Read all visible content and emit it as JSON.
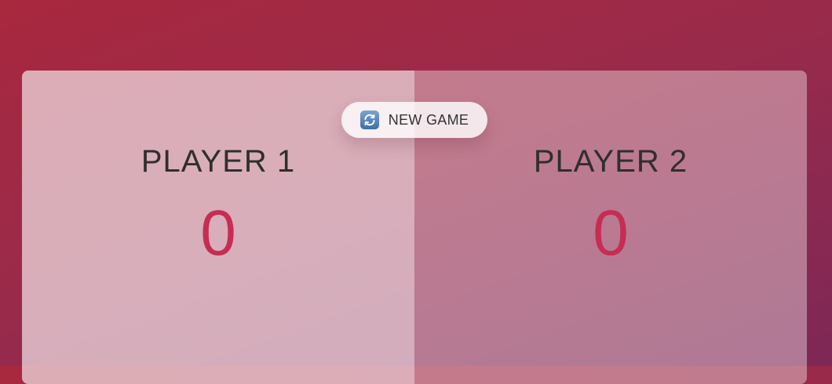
{
  "controls": {
    "new_game_label": "NEW GAME",
    "new_game_icon": "refresh-icon"
  },
  "players": [
    {
      "name": "PLAYER 1",
      "score": "0"
    },
    {
      "name": "PLAYER 2",
      "score": "0"
    }
  ],
  "colors": {
    "background_start": "#a8283e",
    "background_end": "#7e2856",
    "score": "#c62d52",
    "name_text": "#2f2f2f",
    "icon": "#3d6fa6"
  }
}
